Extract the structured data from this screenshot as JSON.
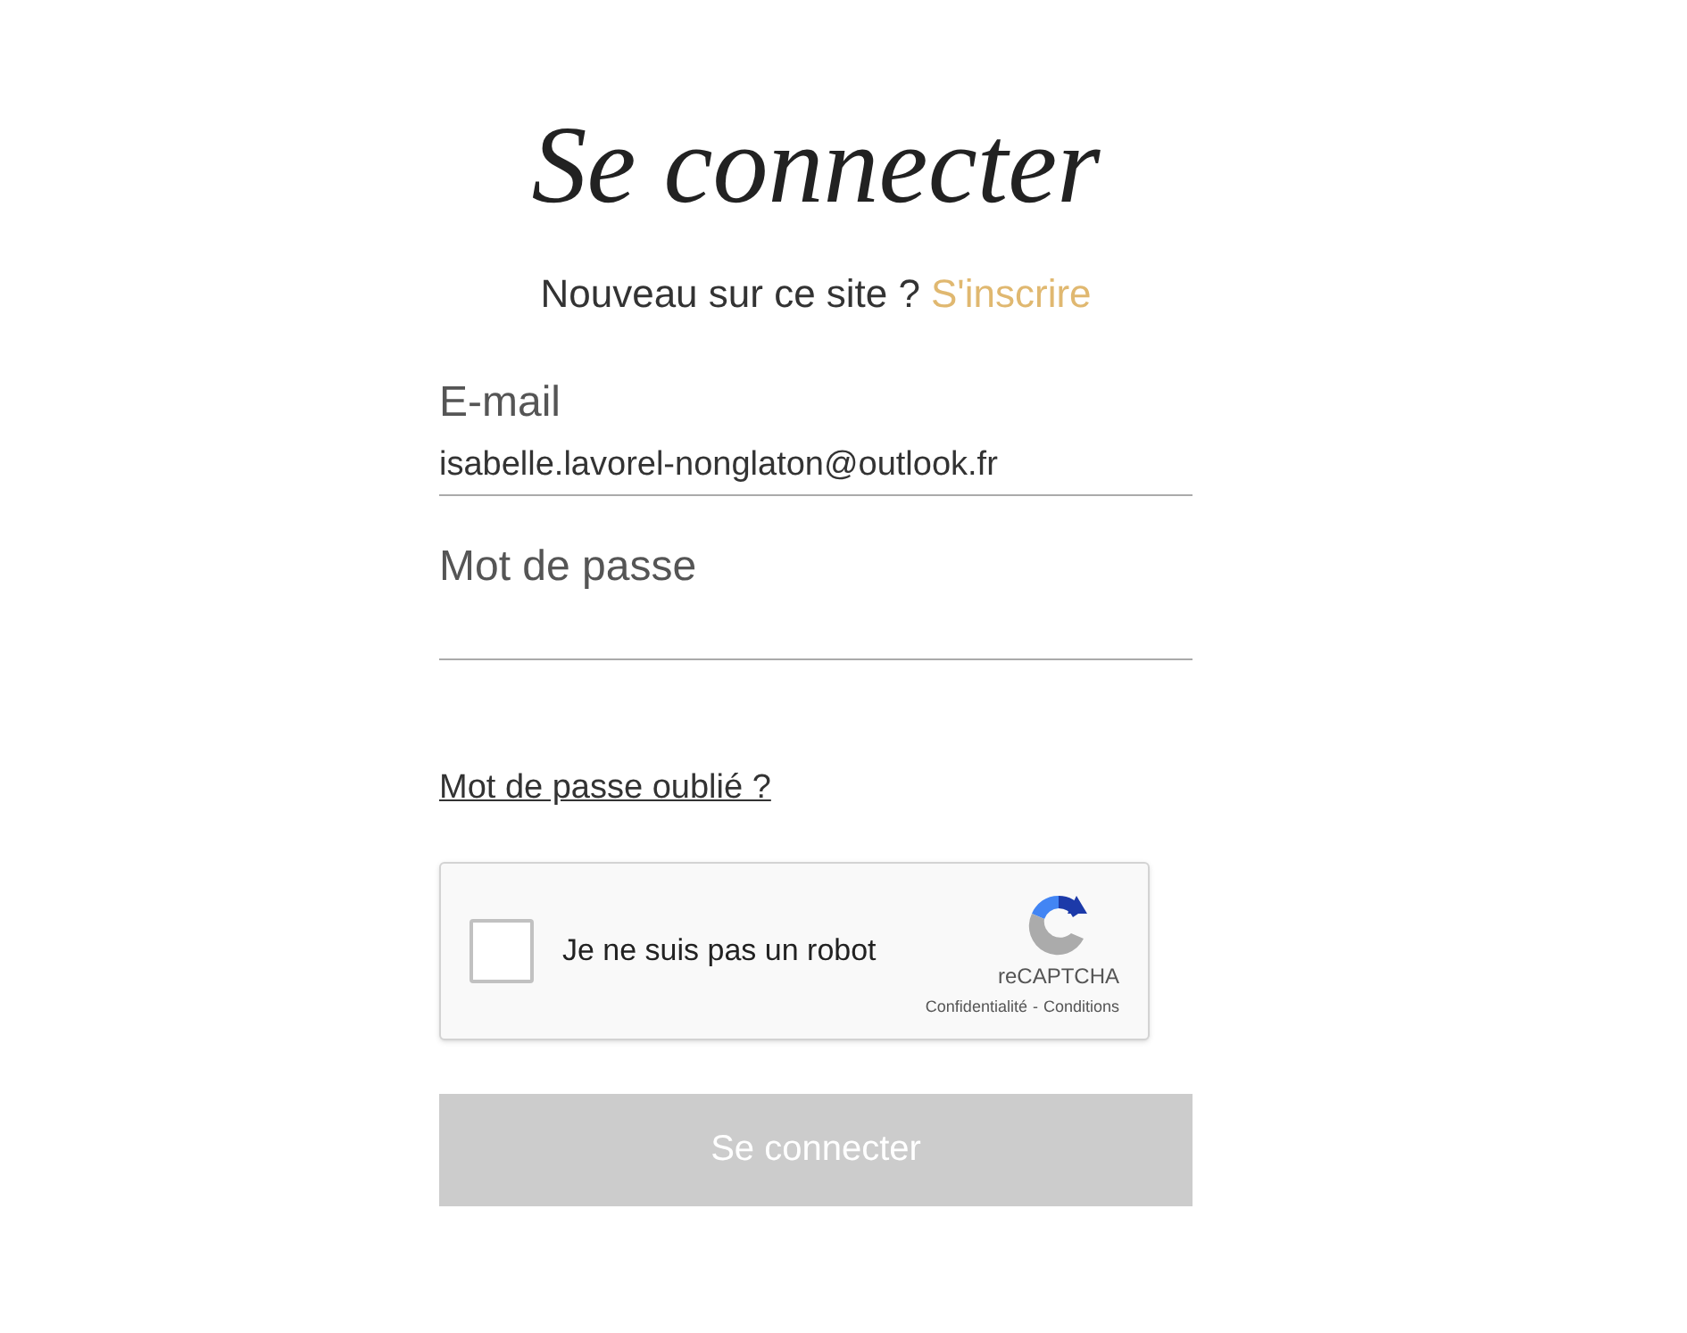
{
  "title": "Se connecter",
  "signup": {
    "text": "Nouveau sur ce site ?",
    "link": "S'inscrire"
  },
  "fields": [
    {
      "label": "E-mail",
      "value": "isabelle.lavorel-nonglaton@outlook.fr"
    },
    {
      "label": "Mot de passe"
    }
  ],
  "forgot_link": "Mot de passe oublié ?",
  "captcha": {
    "label": "Je ne suis pas un robot",
    "checked": false,
    "brand": "reCAPTCHA",
    "privacy": "Confidentialité",
    "separator": "-",
    "terms": "Conditions"
  },
  "submit": {
    "label": "Se connecter",
    "disabled": true
  }
}
